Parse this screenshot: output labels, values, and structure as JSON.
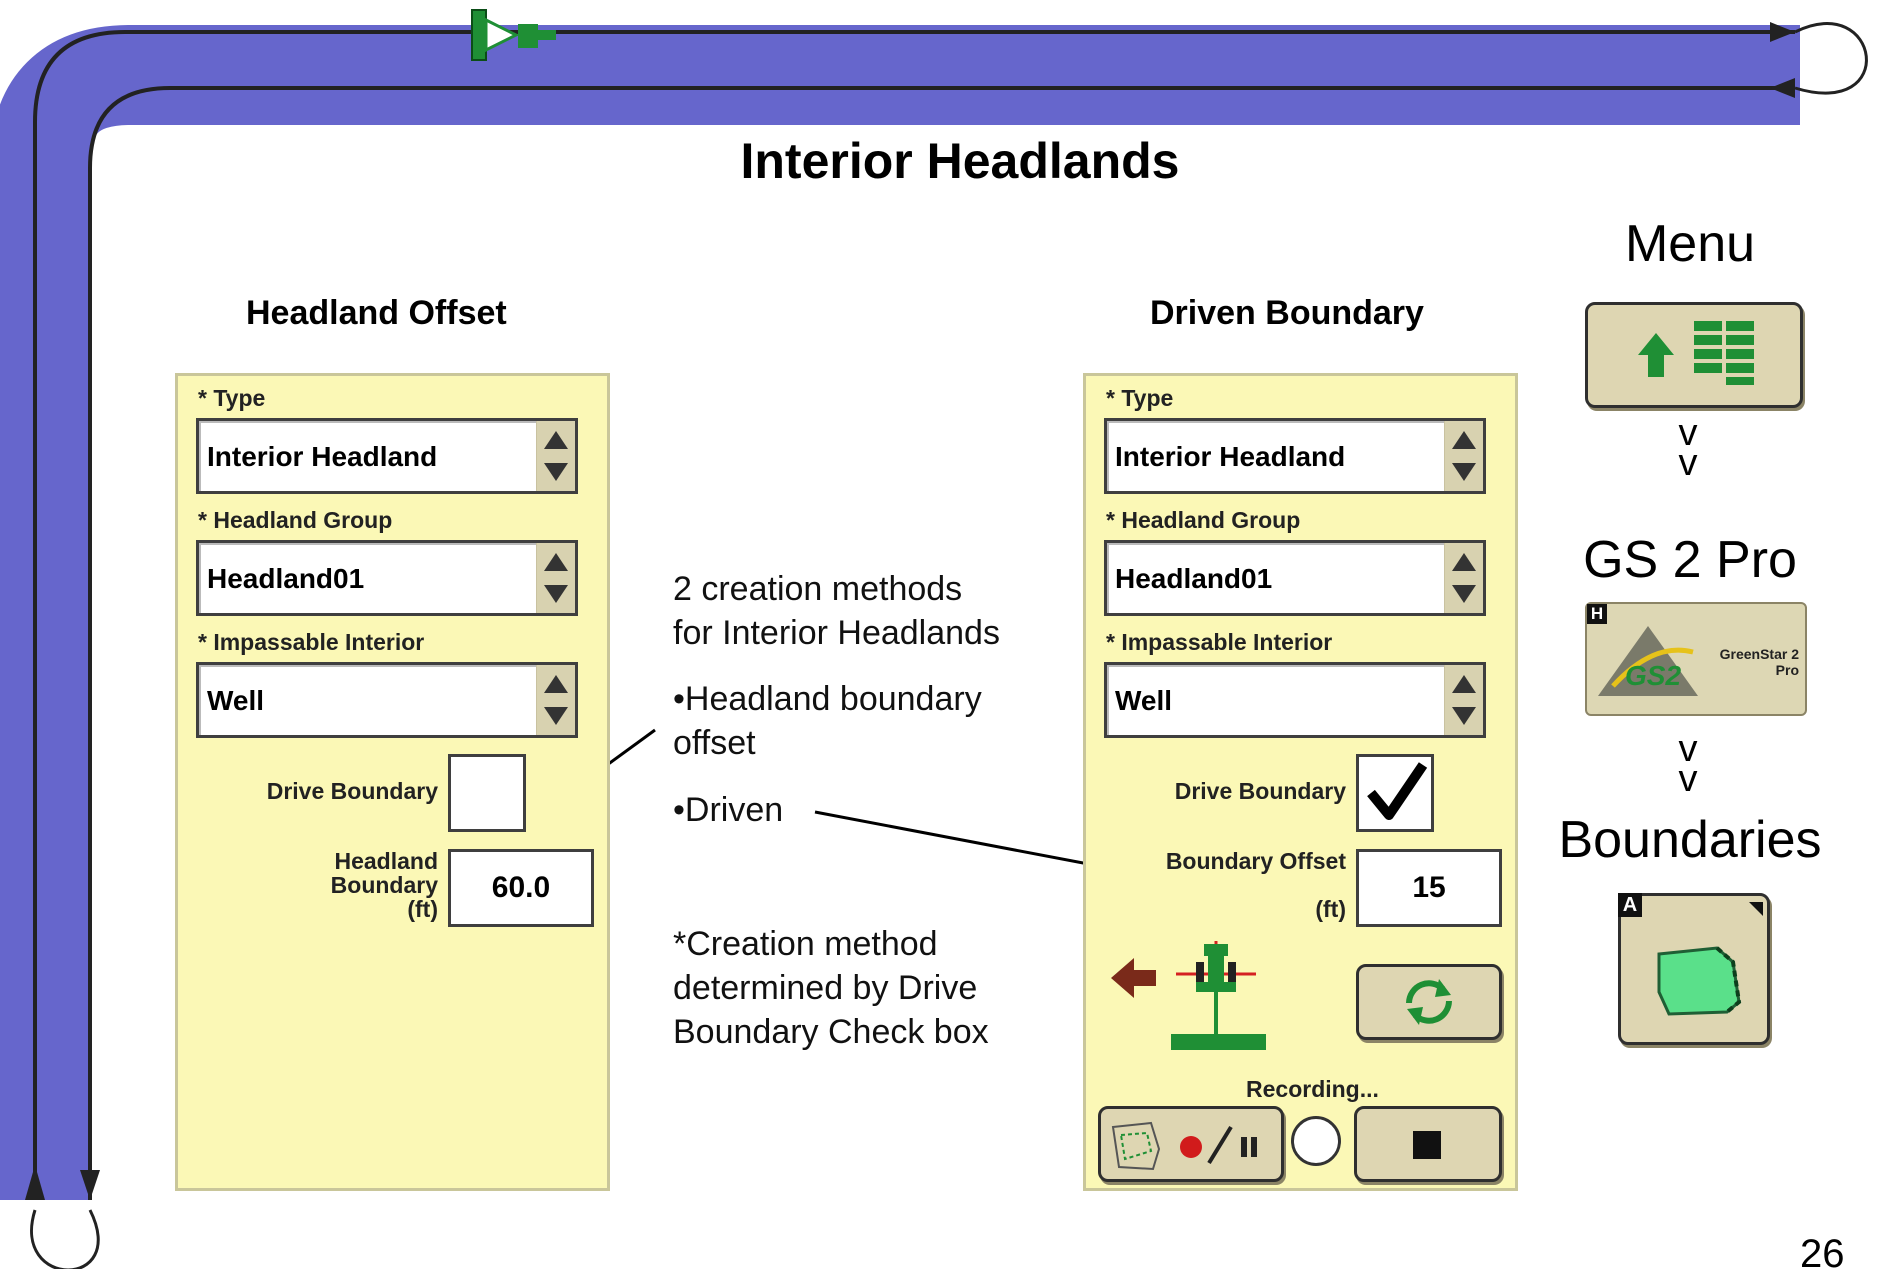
{
  "slide": {
    "title": "Interior Headlands",
    "page_number": "26"
  },
  "left_panel": {
    "heading": "Headland Offset",
    "type_label": "* Type",
    "type_value": "Interior Headland",
    "group_label": "* Headland Group",
    "group_value": "Headland01",
    "interior_label": "* Impassable Interior",
    "interior_value": "Well",
    "drive_boundary_label": "Drive Boundary",
    "drive_boundary_checked": false,
    "headland_boundary_label_line1": "Headland",
    "headland_boundary_label_line2": "Boundary",
    "headland_boundary_unit": "(ft)",
    "headland_boundary_value": "60.0"
  },
  "right_panel": {
    "heading": "Driven Boundary",
    "type_label": "* Type",
    "type_value": "Interior Headland",
    "group_label": "* Headland Group",
    "group_value": "Headland01",
    "interior_label": "* Impassable Interior",
    "interior_value": "Well",
    "drive_boundary_label": "Drive Boundary",
    "drive_boundary_checked": true,
    "boundary_offset_label": "Boundary Offset",
    "boundary_offset_unit": "(ft)",
    "boundary_offset_value": "15",
    "recording_label": "Recording..."
  },
  "notes": {
    "methods_line1": "2 creation methods",
    "methods_line2": "for Interior Headlands",
    "bullet1_line1": "•Headland boundary",
    "bullet1_line2": "offset",
    "bullet2": "•Driven",
    "creation_line1": "*Creation method",
    "creation_line2": "determined by Drive",
    "creation_line3": "Boundary Check box"
  },
  "nav": {
    "menu_label": "Menu",
    "gs2_label": "GS 2 Pro",
    "gs2_badge": "H",
    "gs2_logo_text": "GS2",
    "gs2_product_line1": "GreenStar 2",
    "gs2_product_line2": "Pro",
    "boundaries_label": "Boundaries",
    "boundaries_badge": "A",
    "arrow_glyph": "v"
  },
  "icons": {
    "menu": "menu-grid-icon",
    "tractor": "tractor-icon",
    "refresh": "refresh-icon",
    "record_pause": "record-pause-icon",
    "stop": "stop-icon",
    "boundary_shape": "boundary-shape-icon"
  },
  "colors": {
    "track_fill": "#6666cc",
    "panel_bg": "#fbf8b6",
    "button_bg": "#ded6b2",
    "tractor_green": "#1f8f35",
    "record_red": "#d11b1b",
    "field_green": "#5ae08a"
  }
}
